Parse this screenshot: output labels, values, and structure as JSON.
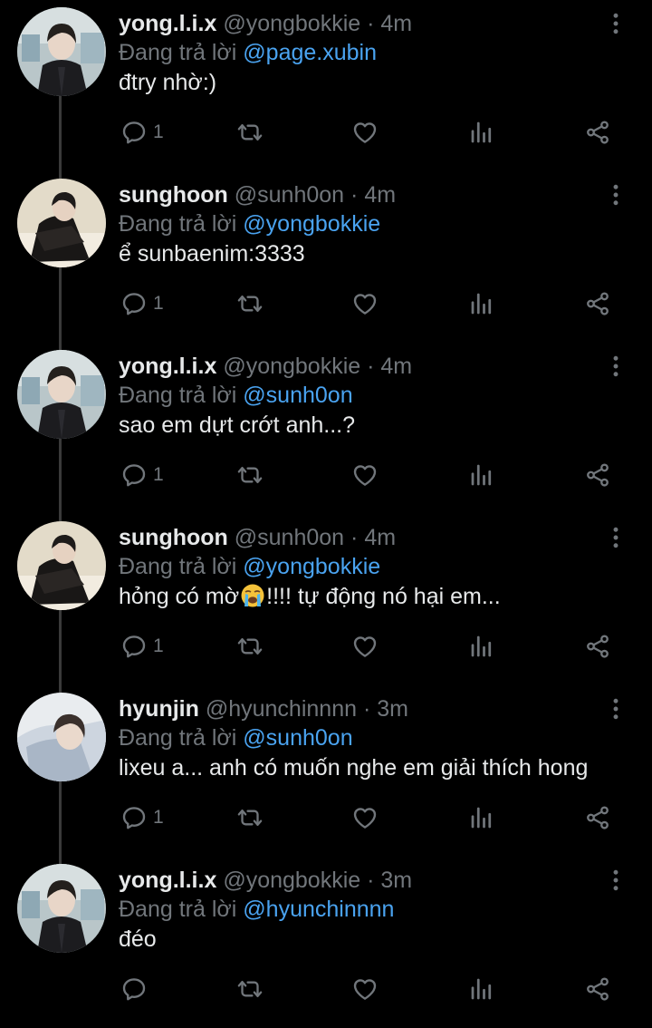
{
  "reply_prefix": "Đang trả lời",
  "tweets": [
    {
      "name": "yong.l.i.x",
      "handle": "@yongbokkie",
      "dot": "·",
      "time": "4m",
      "replying_to": "@page.xubin",
      "text": "đtry nhờ:)",
      "text_after": "",
      "reply_count": "1",
      "avatar": "felix"
    },
    {
      "name": "sunghoon",
      "handle": "@sunh0on",
      "dot": "·",
      "time": "4m",
      "replying_to": "@yongbokkie",
      "text": "ể sunbaenim:3333",
      "text_after": "",
      "reply_count": "1",
      "avatar": "sunghoon"
    },
    {
      "name": "yong.l.i.x",
      "handle": "@yongbokkie",
      "dot": "·",
      "time": "4m",
      "replying_to": "@sunh0on",
      "text": "sao em dựt crớt anh...?",
      "text_after": "",
      "reply_count": "1",
      "avatar": "felix"
    },
    {
      "name": "sunghoon",
      "handle": "@sunh0on",
      "dot": "·",
      "time": "4m",
      "replying_to": "@yongbokkie",
      "text": "hỏng có mờ",
      "emoji": "loudly-crying-face",
      "text_after": "!!!! tự động nó hại em...",
      "reply_count": "1",
      "avatar": "sunghoon"
    },
    {
      "name": "hyunjin",
      "handle": "@hyunchinnnn",
      "dot": "·",
      "time": "3m",
      "replying_to": "@sunh0on",
      "text": "lixeu a... anh có muốn nghe em giải thích hong",
      "text_after": "",
      "reply_count": "1",
      "avatar": "hyunjin"
    },
    {
      "name": "yong.l.i.x",
      "handle": "@yongbokkie",
      "dot": "·",
      "time": "3m",
      "replying_to": "@hyunchinnnn",
      "text": "đéo",
      "text_after": "",
      "reply_count": "",
      "avatar": "felix"
    }
  ],
  "colors": {
    "background": "#000000",
    "text": "#e7e9ea",
    "muted": "#71767b",
    "mention": "#4aa3f0",
    "thread_line": "#3a3a3a"
  }
}
